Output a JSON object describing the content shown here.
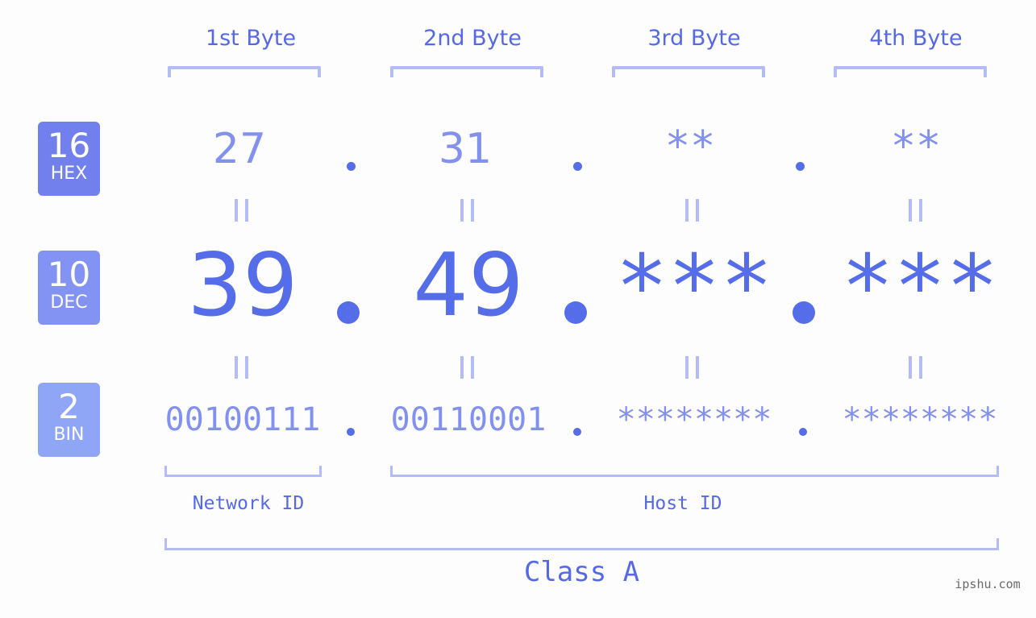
{
  "colors": {
    "primary": "#556de8",
    "light": "#8290ee",
    "bracket": "#b3bcf7",
    "hex_badge": "#7180ec",
    "dec_badge": "#8393f3",
    "bin_badge": "#8fa6f7",
    "background": "#fcfdfc"
  },
  "byte_headers": [
    "1st Byte",
    "2nd Byte",
    "3rd Byte",
    "4th Byte"
  ],
  "rows": {
    "hex": {
      "base": "16",
      "label": "HEX",
      "values": [
        "27",
        "31",
        "**",
        "**"
      ]
    },
    "dec": {
      "base": "10",
      "label": "DEC",
      "values": [
        "39",
        "49",
        "***",
        "***"
      ]
    },
    "bin": {
      "base": "2",
      "label": "BIN",
      "values": [
        "00100111",
        "00110001",
        "********",
        "********"
      ]
    }
  },
  "equals_symbol": "||",
  "segments": {
    "network": "Network ID",
    "host": "Host ID"
  },
  "ip_class": "Class A",
  "watermark": "ipshu.com"
}
